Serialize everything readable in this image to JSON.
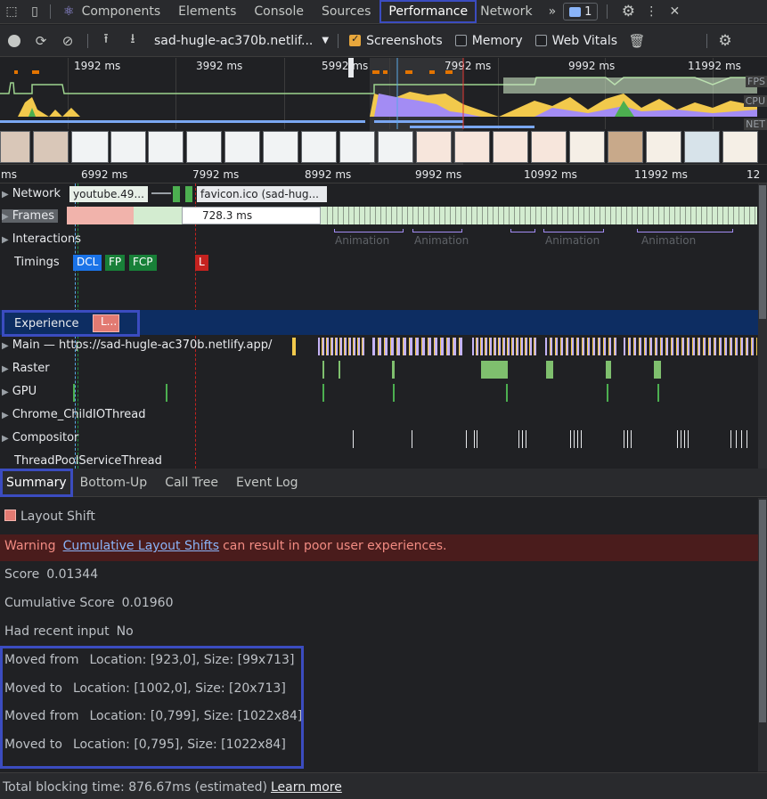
{
  "tabbar": {
    "tabs": [
      {
        "label": "Components",
        "active": false
      },
      {
        "label": "Elements",
        "active": false
      },
      {
        "label": "Console",
        "active": false
      },
      {
        "label": "Sources",
        "active": false
      },
      {
        "label": "Performance",
        "active": true
      },
      {
        "label": "Network",
        "active": false
      }
    ],
    "more": "»",
    "issues_count": "1"
  },
  "toolbar": {
    "profile_select": "sad-hugle-ac370b.netlif...",
    "screenshots_label": "Screenshots",
    "memory_label": "Memory",
    "webvitals_label": "Web Vitals",
    "screenshots_checked": true,
    "memory_checked": false,
    "webvitals_checked": false
  },
  "overview": {
    "ticks": [
      "1992 ms",
      "3992 ms",
      "5992 ms",
      "7992 ms",
      "9992 ms",
      "11992 ms"
    ],
    "fps_label": "FPS",
    "cpu_label": "CPU",
    "net_label": "NET"
  },
  "ruler": {
    "ticks": [
      "ms",
      "6992 ms",
      "7992 ms",
      "8992 ms",
      "9992 ms",
      "10992 ms",
      "11992 ms",
      "12"
    ]
  },
  "tracks": {
    "network": {
      "label": "Network",
      "item1": "youtube.49...",
      "item2": "favicon.ico (sad-hug..."
    },
    "frames": {
      "label": "Frames",
      "frame_time": "728.3 ms"
    },
    "interactions": {
      "label": "Interactions",
      "animations": [
        "Animation",
        "Animation",
        "Animation",
        "Animation",
        "Animation"
      ]
    },
    "timings": {
      "label": "Timings",
      "dcl": "DCL",
      "fp": "FP",
      "fcp": "FCP",
      "l": "L"
    },
    "experience": {
      "label": "Experience",
      "chip": "L..."
    },
    "main": {
      "label": "Main — https://sad-hugle-ac370b.netlify.app/"
    },
    "raster": {
      "label": "Raster"
    },
    "gpu": {
      "label": "GPU"
    },
    "childio": {
      "label": "Chrome_ChildIOThread"
    },
    "compositor": {
      "label": "Compositor"
    },
    "threadpool": {
      "label": "ThreadPoolServiceThread"
    }
  },
  "details_tabs": [
    {
      "label": "Summary",
      "active": true
    },
    {
      "label": "Bottom-Up",
      "active": false
    },
    {
      "label": "Call Tree",
      "active": false
    },
    {
      "label": "Event Log",
      "active": false
    }
  ],
  "summary": {
    "title": "Layout Shift",
    "warning_label": "Warning",
    "warning_link": "Cumulative Layout Shifts",
    "warning_rest": "can result in poor user experiences.",
    "score_label": "Score",
    "score_value": "0.01344",
    "cumulative_label": "Cumulative Score",
    "cumulative_value": "0.01960",
    "recent_input_label": "Had recent input",
    "recent_input_value": "No",
    "moves": [
      {
        "label": "Moved from",
        "value": "Location: [923,0], Size: [99x713]"
      },
      {
        "label": "Moved to",
        "value": "Location: [1002,0], Size: [20x713]"
      },
      {
        "label": "Moved from",
        "value": "Location: [0,799], Size: [1022x84]"
      },
      {
        "label": "Moved to",
        "value": "Location: [0,795], Size: [1022x84]"
      }
    ]
  },
  "footer": {
    "text": "Total blocking time: 876.67ms (estimated)",
    "link": "Learn more"
  },
  "colors": {
    "highlight": "#3b4cc0",
    "experience_row": "#0d2d62",
    "layout_shift": "#e27a72",
    "warning_bg": "#4a1c1c",
    "warning_text": "#f28b82",
    "dcl": "#1a73e8",
    "fp": "#188038",
    "l": "#c5221f"
  }
}
